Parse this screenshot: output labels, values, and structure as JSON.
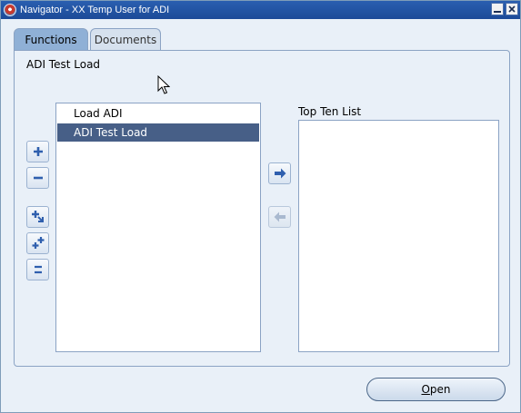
{
  "window": {
    "title": "Navigator - XX Temp User for ADI"
  },
  "tabs": [
    {
      "label": "Functions",
      "active": true
    },
    {
      "label": "Documents",
      "active": false
    }
  ],
  "functions_panel": {
    "current_function": "ADI Test Load",
    "function_list": [
      {
        "label": "Load ADI",
        "selected": false
      },
      {
        "label": "ADI Test Load",
        "selected": true
      }
    ],
    "top_ten_label": "Top Ten List",
    "top_ten_items": []
  },
  "buttons": {
    "open_mnemonic": "O",
    "open_rest": "pen"
  },
  "icons": {
    "expand": "plus-icon",
    "collapse": "minus-icon",
    "expand_branch": "expand-branch-icon",
    "expand_all": "expand-all-icon",
    "collapse_all": "collapse-all-icon",
    "add_to_top_ten": "arrow-right-icon",
    "remove_from_top_ten": "arrow-left-icon"
  },
  "colors": {
    "titlebar": "#1c4a98",
    "selection": "#475f87",
    "active_tab": "#8fb0d6",
    "icon_blue": "#2f5fae"
  }
}
